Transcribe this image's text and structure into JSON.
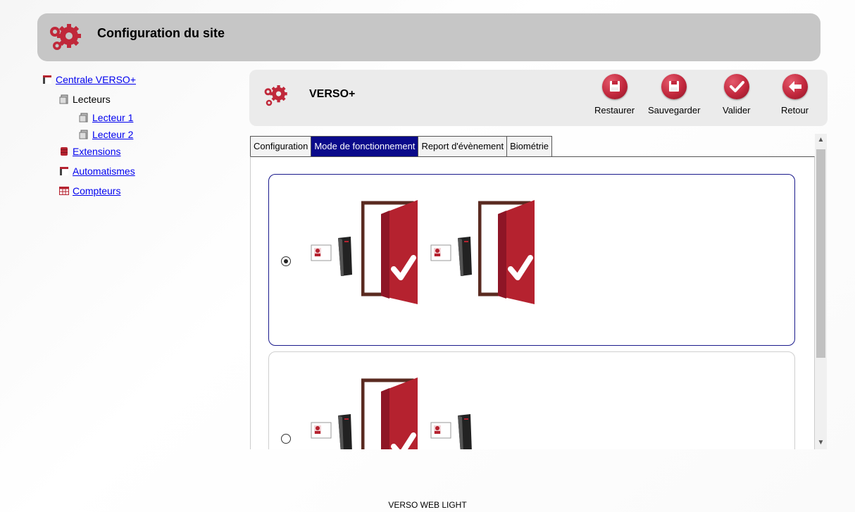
{
  "header": {
    "title": "Configuration du site",
    "icon": "gears-icon"
  },
  "tree": {
    "root": "Centrale VERSO+",
    "readers_group": "Lecteurs",
    "reader1": "Lecteur 1",
    "reader2": "Lecteur 2",
    "extensions": "Extensions",
    "automations": "Automatismes",
    "counters": "Compteurs"
  },
  "device": {
    "name": "VERSO+",
    "buttons": {
      "restore": "Restaurer",
      "save": "Sauvegarder",
      "validate": "Valider",
      "back": "Retour"
    }
  },
  "tabs": [
    "Configuration",
    "Mode de fonctionnement",
    "Report d'évènement",
    "Biométrie"
  ],
  "active_tab": "Mode de fonctionnement",
  "modes": [
    {
      "selected": true,
      "description_icons": [
        "card-reader-icon",
        "door-open-check-icon",
        "card-reader-icon",
        "door-open-check-icon"
      ]
    },
    {
      "selected": false,
      "description_icons": [
        "card-reader-icon",
        "door-open-check-icon",
        "card-reader-icon"
      ]
    }
  ],
  "footer": {
    "text": "VERSO WEB LIGHT"
  },
  "colors": {
    "accent": "#0a0a8a",
    "door_red": "#b5222f",
    "header_grey": "#c6c6c6"
  }
}
